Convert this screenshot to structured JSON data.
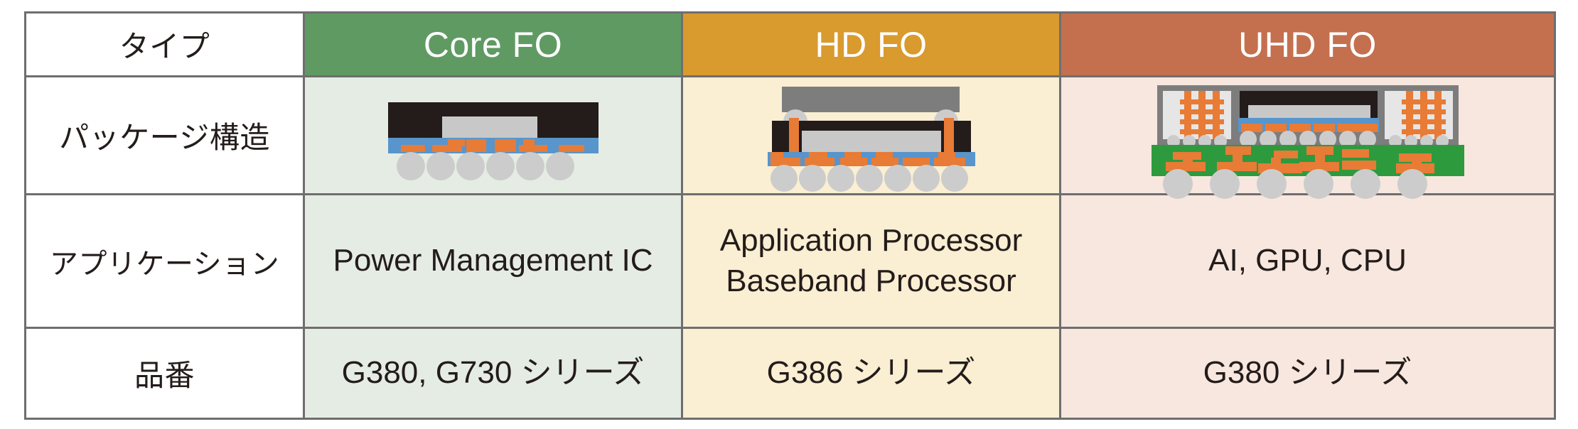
{
  "table": {
    "row_labels": {
      "type": "タイプ",
      "package_structure": "パッケージ構造",
      "application": "アプリケーション",
      "part_number": "品番"
    },
    "columns": [
      {
        "key": "core_fo",
        "header": "Core FO",
        "header_color": "#5f9a63",
        "tint_color": "#e5ece4",
        "package_structure": "core-fo-package-diagram",
        "application_lines": [
          "Power Management IC"
        ],
        "part_number": "G380, G730 シリーズ"
      },
      {
        "key": "hd_fo",
        "header": "HD FO",
        "header_color": "#d99a2e",
        "tint_color": "#faeed3",
        "package_structure": "hd-fo-package-diagram",
        "application_lines": [
          "Application Processor",
          "Baseband Processor"
        ],
        "part_number": "G386 シリーズ"
      },
      {
        "key": "uhd_fo",
        "header": "UHD FO",
        "header_color": "#c4704f",
        "tint_color": "#f7e7df",
        "package_structure": "uhd-fo-package-diagram",
        "application_lines": [
          "AI, GPU, CPU"
        ],
        "part_number": "G380 シリーズ"
      }
    ]
  },
  "diagram_colors": {
    "mold_compound": "#231c1a",
    "die": "#c8c8c8",
    "rdl_layer": "#5795cc",
    "copper_trace": "#e87b35",
    "solder_ball": "#cccccc",
    "heat_spreader": "#7d7d7d",
    "substrate": "#2e9a3e",
    "hbm_stack": "#e6e6e6",
    "border": "#6e6e6e"
  }
}
